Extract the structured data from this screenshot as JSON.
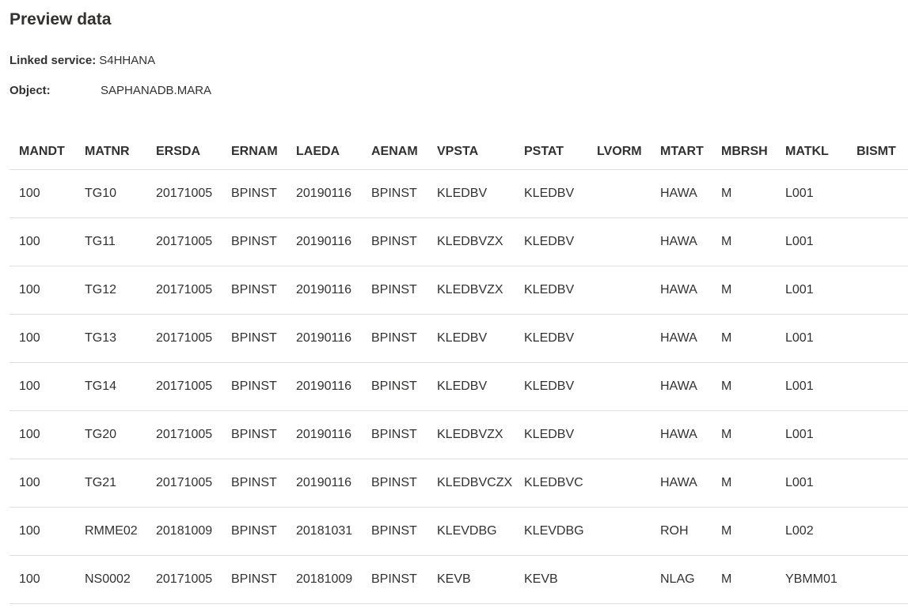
{
  "title": "Preview data",
  "linked_service": {
    "label": "Linked service:",
    "value": "S4HHANA"
  },
  "object": {
    "label": "Object:",
    "value": "SAPHANADB.MARA"
  },
  "table": {
    "columns": [
      "MANDT",
      "MATNR",
      "ERSDA",
      "ERNAM",
      "LAEDA",
      "AENAM",
      "VPSTA",
      "PSTAT",
      "LVORM",
      "MTART",
      "MBRSH",
      "MATKL",
      "BISMT"
    ],
    "rows": [
      [
        "100",
        "TG10",
        "20171005",
        "BPINST",
        "20190116",
        "BPINST",
        "KLEDBV",
        "KLEDBV",
        "",
        "HAWA",
        "M",
        "L001",
        ""
      ],
      [
        "100",
        "TG11",
        "20171005",
        "BPINST",
        "20190116",
        "BPINST",
        "KLEDBVZX",
        "KLEDBV",
        "",
        "HAWA",
        "M",
        "L001",
        ""
      ],
      [
        "100",
        "TG12",
        "20171005",
        "BPINST",
        "20190116",
        "BPINST",
        "KLEDBVZX",
        "KLEDBV",
        "",
        "HAWA",
        "M",
        "L001",
        ""
      ],
      [
        "100",
        "TG13",
        "20171005",
        "BPINST",
        "20190116",
        "BPINST",
        "KLEDBV",
        "KLEDBV",
        "",
        "HAWA",
        "M",
        "L001",
        ""
      ],
      [
        "100",
        "TG14",
        "20171005",
        "BPINST",
        "20190116",
        "BPINST",
        "KLEDBV",
        "KLEDBV",
        "",
        "HAWA",
        "M",
        "L001",
        ""
      ],
      [
        "100",
        "TG20",
        "20171005",
        "BPINST",
        "20190116",
        "BPINST",
        "KLEDBVZX",
        "KLEDBV",
        "",
        "HAWA",
        "M",
        "L001",
        ""
      ],
      [
        "100",
        "TG21",
        "20171005",
        "BPINST",
        "20190116",
        "BPINST",
        "KLEDBVCZX",
        "KLEDBVC",
        "",
        "HAWA",
        "M",
        "L001",
        ""
      ],
      [
        "100",
        "RMME02",
        "20181009",
        "BPINST",
        "20181031",
        "BPINST",
        "KLEVDBG",
        "KLEVDBG",
        "",
        "ROH",
        "M",
        "L002",
        ""
      ],
      [
        "100",
        "NS0002",
        "20171005",
        "BPINST",
        "20181009",
        "BPINST",
        "KEVB",
        "KEVB",
        "",
        "NLAG",
        "M",
        "YBMM01",
        ""
      ]
    ]
  }
}
